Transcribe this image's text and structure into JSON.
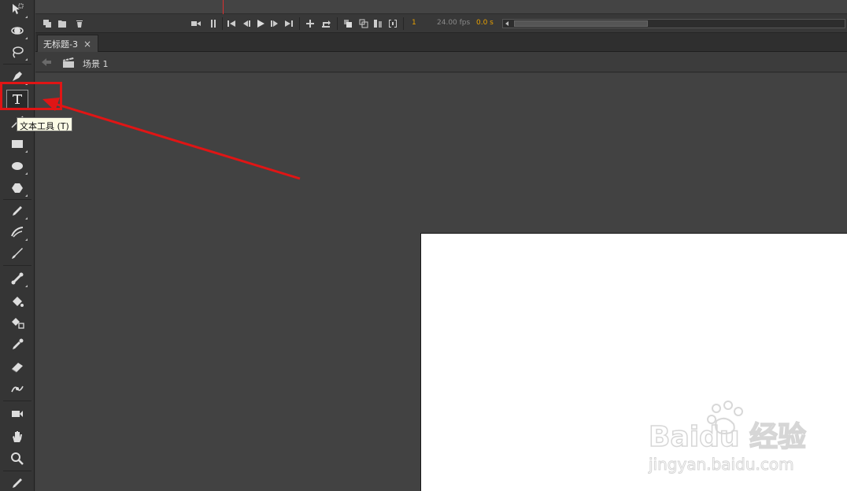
{
  "tabs": [
    {
      "label": "无标题-3",
      "close": "×"
    }
  ],
  "editbar": {
    "scene_label": "场景 1"
  },
  "timeline": {
    "current_frame": "1",
    "frame_rate": "24.00 fps",
    "elapsed_time": "0.0 s"
  },
  "tooltip": {
    "text": "文本工具 (T)"
  },
  "tools": [
    "selection-tool",
    "3d-rotation-tool",
    "lasso-tool",
    "pen-tool",
    "text-tool",
    "line-tool",
    "rectangle-tool",
    "oval-tool",
    "polystar-tool",
    "pencil-tool",
    "brush-tool",
    "paint-brush-tool",
    "bone-tool",
    "paint-bucket-tool",
    "ink-bottle-tool",
    "eyedropper-tool",
    "eraser-tool",
    "width-tool",
    "camera-tool",
    "hand-tool",
    "zoom-tool",
    "stroke-color-tool"
  ],
  "watermark": {
    "brand": "Baidu 经验",
    "url": "jingyan.baidu.com"
  },
  "colors": {
    "highlight": "#e01515",
    "accent_orange": "#e8a000",
    "stage": "#ffffff",
    "playhead": "#d93030"
  }
}
